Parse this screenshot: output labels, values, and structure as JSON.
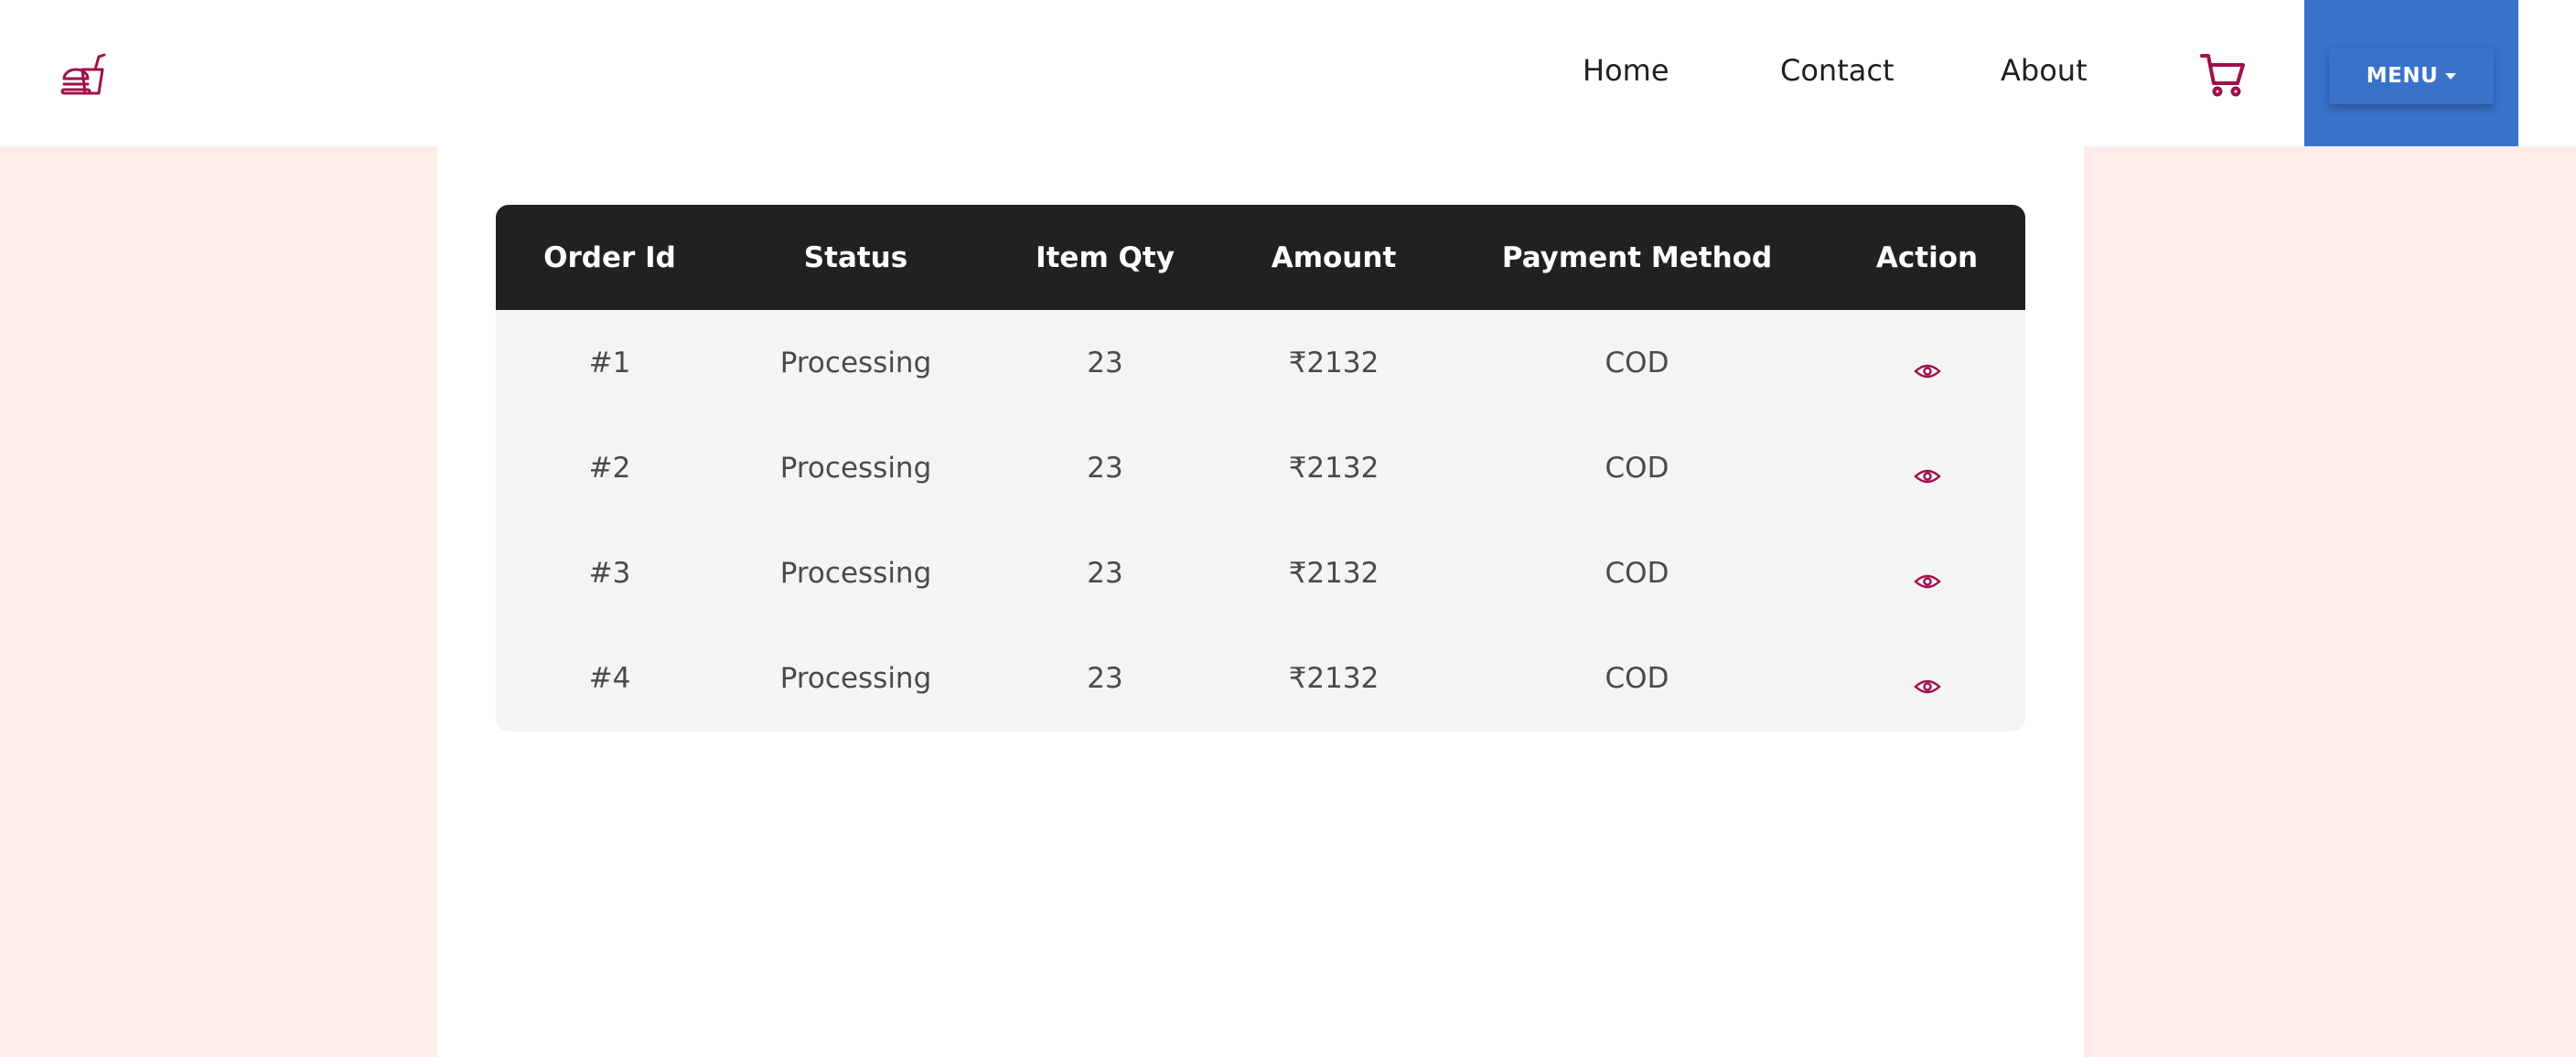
{
  "header": {
    "logo_icon": "food-burger-drink-icon",
    "nav": {
      "home": "Home",
      "contact": "Contact",
      "about": "About"
    },
    "cart_icon": "cart-icon",
    "menu_label": "MENU"
  },
  "orders_table": {
    "columns": [
      "Order Id",
      "Status",
      "Item Qty",
      "Amount",
      "Payment Method",
      "Action"
    ],
    "rows": [
      {
        "order_id": "#1",
        "status": "Processing",
        "item_qty": "23",
        "amount": "₹2132",
        "payment_method": "COD",
        "action_icon": "eye-icon"
      },
      {
        "order_id": "#2",
        "status": "Processing",
        "item_qty": "23",
        "amount": "₹2132",
        "payment_method": "COD",
        "action_icon": "eye-icon"
      },
      {
        "order_id": "#3",
        "status": "Processing",
        "item_qty": "23",
        "amount": "₹2132",
        "payment_method": "COD",
        "action_icon": "eye-icon"
      },
      {
        "order_id": "#4",
        "status": "Processing",
        "item_qty": "23",
        "amount": "₹2132",
        "payment_method": "COD",
        "action_icon": "eye-icon"
      }
    ]
  },
  "colors": {
    "accent": "#a0104a",
    "menu_blue": "#3a72c9",
    "table_header": "#212121",
    "page_bg": "#fdecea"
  }
}
